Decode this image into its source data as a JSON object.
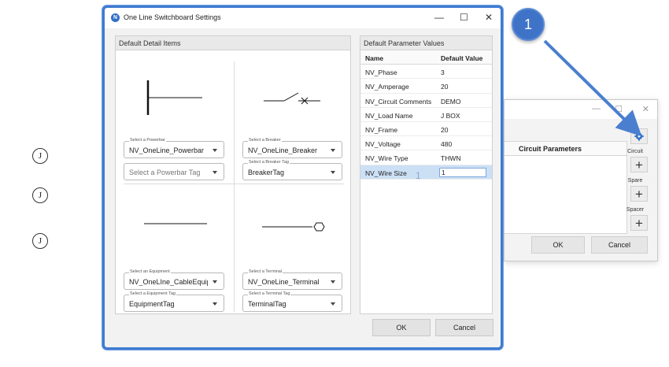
{
  "markers": {
    "j1": "J",
    "j2": "J",
    "j3": "J"
  },
  "dialog": {
    "title": "One Line Switchboard Settings",
    "app_icon": "N",
    "detail_items": {
      "header": "Default Detail Items",
      "powerbar": {
        "legend": "Select a Powerbar",
        "value": "NV_OneLine_Powerbar",
        "tag_placeholder": "Select a Powerbar Tag"
      },
      "breaker": {
        "legend": "Select a Breaker",
        "value": "NV_OneLine_Breaker",
        "tag_legend": "Select a Breaker Tag",
        "tag_value": "BreakerTag"
      },
      "equipment": {
        "legend": "Select an Equipment",
        "value": "NV_OneLIne_CableEquipm",
        "tag_legend": "Select a Equipment Tag",
        "tag_value": "EquipmentTag"
      },
      "terminal": {
        "legend": "Select a Terminal",
        "value": "NV_OneLine_Terminal",
        "tag_legend": "Select a Terminal Tag",
        "tag_value": "TerminalTag"
      }
    },
    "parameters": {
      "header": "Default Parameter Values",
      "col_name": "Name",
      "col_value": "Default Value",
      "rows": [
        {
          "name": "NV_Phase",
          "value": "3"
        },
        {
          "name": "NV_Amperage",
          "value": "20"
        },
        {
          "name": "NV_Circuit Comments",
          "value": "DEMO"
        },
        {
          "name": "NV_Load Name",
          "value": "J BOX"
        },
        {
          "name": "NV_Frame",
          "value": "20"
        },
        {
          "name": "NV_Voltage",
          "value": "480"
        },
        {
          "name": "NV_Wire Type",
          "value": "THWN"
        },
        {
          "name": "NV_Wire Size",
          "value": "1"
        }
      ],
      "selected_index": 7,
      "overlay_digit": "1"
    },
    "ok_label": "OK",
    "cancel_label": "Cancel"
  },
  "background_dialog": {
    "panel_header": "Circuit Parameters",
    "circuit_label": "Circuit",
    "spare_label": "Spare",
    "spacer_label": "Spacer",
    "plus": "+",
    "ok_label": "OK",
    "cancel_label": "Cancel"
  },
  "callout": {
    "number": "1",
    "color": "#3f73c8"
  },
  "colors": {
    "accent": "#3f7bd1",
    "selection": "#cce0f5"
  }
}
